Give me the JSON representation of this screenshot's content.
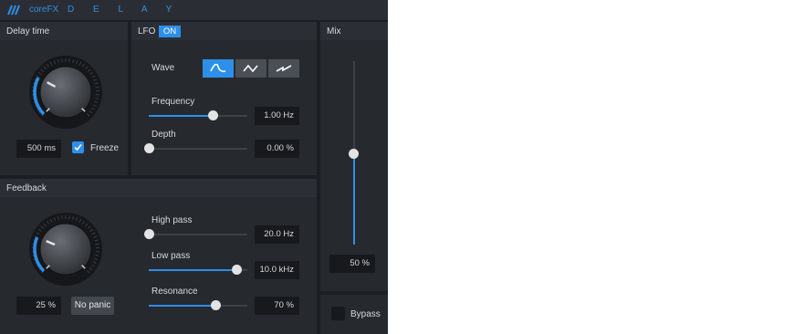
{
  "app": {
    "name": "coreFX",
    "subtitle": "D E L A Y"
  },
  "colors": {
    "accent": "#2d8fe8",
    "background": "#1b1e22",
    "panel": "#26292e"
  },
  "delay_time": {
    "title": "Delay time",
    "value": "500 ms",
    "knob_level": 0.27,
    "freeze": {
      "label": "Freeze",
      "checked": true
    }
  },
  "lfo": {
    "title": "LFO",
    "state": "ON",
    "wave": {
      "label": "Wave",
      "options": [
        "sine-wave-icon",
        "triangle-wave-icon",
        "sawtooth-wave-icon"
      ],
      "selected": 0
    },
    "frequency": {
      "label": "Frequency",
      "value": "1.00 Hz",
      "level": 0.65
    },
    "depth": {
      "label": "Depth",
      "value": "0.00 %",
      "level": 0.0
    }
  },
  "mix": {
    "title": "Mix",
    "value": "50 %",
    "level": 0.5
  },
  "feedback": {
    "title": "Feedback",
    "value": "25 %",
    "knob_level": 0.25,
    "no_panic_label": "No panic",
    "high_pass": {
      "label": "High pass",
      "value": "20.0 Hz",
      "level": 0.0
    },
    "low_pass": {
      "label": "Low pass",
      "value": "10.0 kHz",
      "level": 0.89
    },
    "resonance": {
      "label": "Resonance",
      "value": "70 %",
      "level": 0.68
    }
  },
  "bypass": {
    "label": "Bypass",
    "checked": false
  }
}
